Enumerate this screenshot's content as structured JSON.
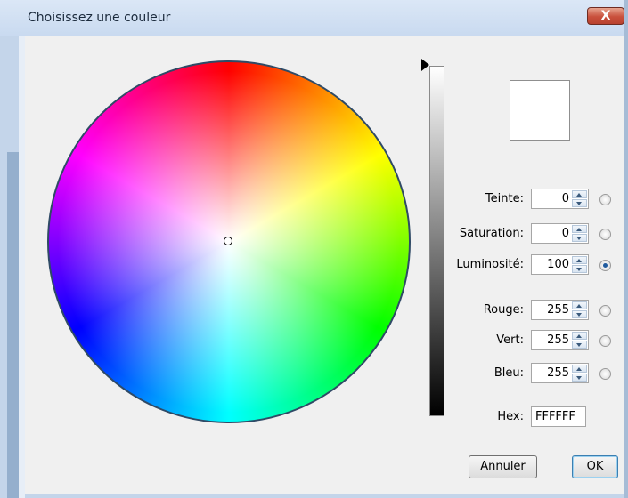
{
  "window": {
    "title": "Choisissez une couleur",
    "close_glyph": "X"
  },
  "fields": {
    "hue": {
      "label": "Teinte:",
      "value": "0"
    },
    "saturation": {
      "label": "Saturation:",
      "value": "0"
    },
    "luminosity": {
      "label": "Luminosité:",
      "value": "100"
    },
    "red": {
      "label": "Rouge:",
      "value": "255"
    },
    "green": {
      "label": "Vert:",
      "value": "255"
    },
    "blue": {
      "label": "Bleu:",
      "value": "255"
    }
  },
  "selected_mode": "luminosity",
  "hex": {
    "label": "Hex:",
    "value": "FFFFFF"
  },
  "preview_color": "#FFFFFF",
  "luminosity_level": 1.0,
  "buttons": {
    "cancel": "Annuler",
    "ok": "OK"
  }
}
